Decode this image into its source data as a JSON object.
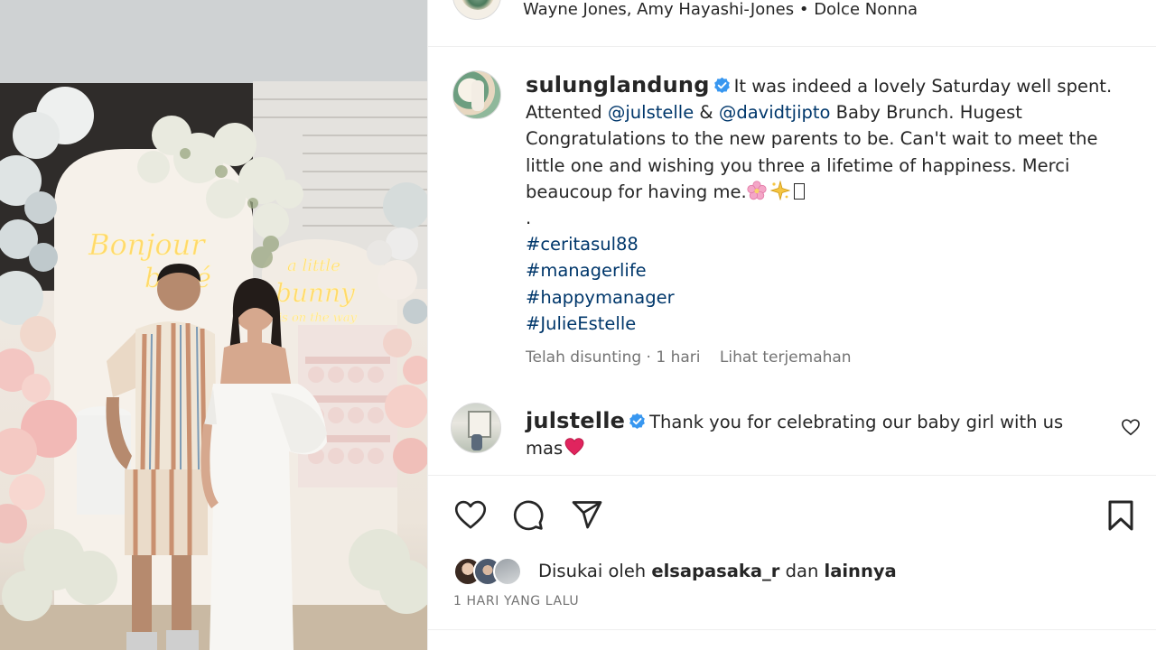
{
  "header": {
    "names": "Wayne Jones, Amy Hayashi-Jones",
    "separator": "•",
    "location": "Dolce Nonna"
  },
  "photo": {
    "neon_left_line1": "Bonjour",
    "neon_left_line2": "bébé",
    "neon_right_line1": "a little",
    "neon_right_line2": "bunny",
    "neon_right_line3": "is on the way"
  },
  "caption": {
    "username": "sulunglandung",
    "text_1": "It was indeed a lovely Saturday well spent. Attented",
    "mention_1": "@julstelle",
    "text_2": "&",
    "mention_2": "@davidtjipto",
    "text_3": "Baby Brunch. Hugest Congratulations to the new parents to be. Can't wait to meet the little one and wishing you three a lifetime of happiness. Merci beaucoup for having me.",
    "dot": ".",
    "hashtags": [
      "#ceritasul88",
      "#managerlife",
      "#happymanager",
      "#JulieEstelle"
    ]
  },
  "meta": {
    "edited": "Telah disunting · 1 hari",
    "translate": "Lihat terjemahan"
  },
  "comment": {
    "username": "julstelle",
    "text": "Thank you for celebrating our baby girl with us mas"
  },
  "likes": {
    "prefix": "Disukai oleh",
    "user": "elsapasaka_r",
    "middle": "dan",
    "others": "lainnya"
  },
  "date": "1 HARI YANG LALU",
  "icons": [
    "heart-icon",
    "comment-icon",
    "share-icon",
    "bookmark-icon",
    "verified-badge-icon"
  ],
  "colors": {
    "link": "#00376b",
    "verified": "#3897f0",
    "muted": "#737373",
    "text": "#262626",
    "emoji_heart": "#e0245e"
  }
}
